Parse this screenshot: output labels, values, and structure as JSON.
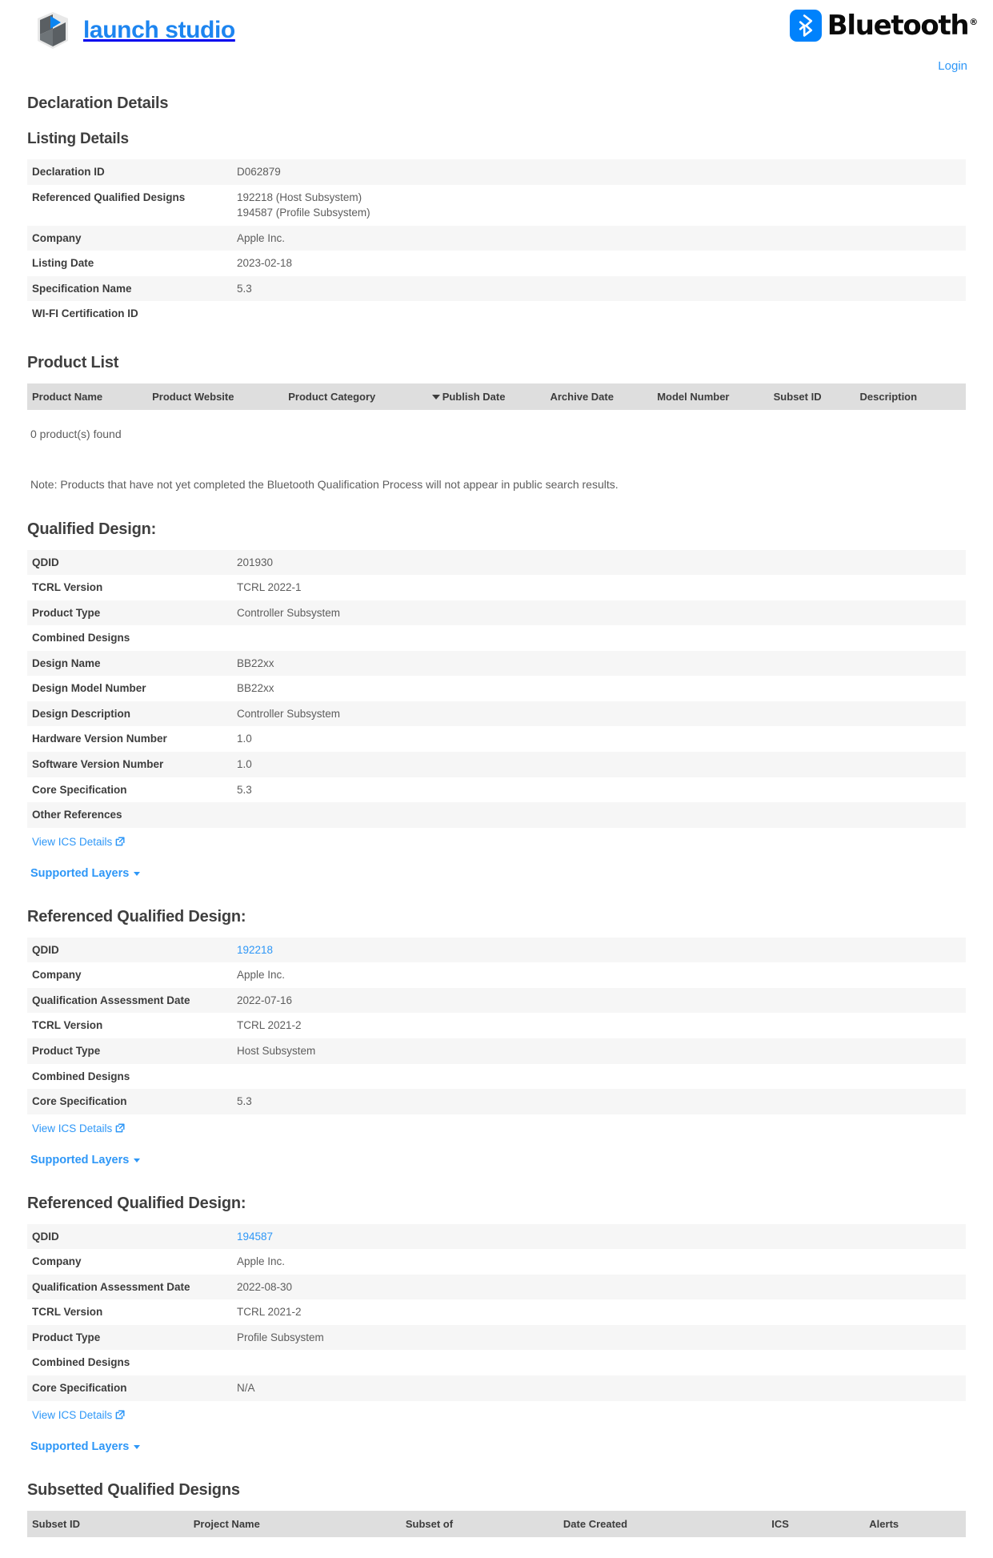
{
  "header": {
    "brand_text": "launch studio",
    "brand_color": "#1d85f0",
    "bluetooth_text": "Bluetooth",
    "bluetooth_reg": "®",
    "bluetooth_color": "#0082fc",
    "login_label": "Login"
  },
  "page": {
    "title": "Declaration Details"
  },
  "listing_details": {
    "title": "Listing Details",
    "rows": [
      {
        "label": "Declaration ID",
        "value": "D062879"
      },
      {
        "label": "Referenced Qualified Designs",
        "value_lines": [
          "192218 (Host Subsystem)",
          "194587 (Profile Subsystem)"
        ]
      },
      {
        "label": "Company",
        "value": "Apple Inc."
      },
      {
        "label": "Listing Date",
        "value": "2023-02-18"
      },
      {
        "label": "Specification Name",
        "value": "5.3"
      },
      {
        "label": "WI-FI Certification ID",
        "value": ""
      }
    ]
  },
  "product_list": {
    "title": "Product List",
    "columns": [
      "Product Name",
      "Product Website",
      "Product Category",
      "Publish Date",
      "Archive Date",
      "Model Number",
      "Subset ID",
      "Description"
    ],
    "sorted_column": "Publish Date",
    "sort_direction": "desc",
    "result_count_text": "0 product(s) found",
    "note": "Note: Products that have not yet completed the Bluetooth Qualification Process will not appear in public search results."
  },
  "qualified_design": {
    "title": "Qualified Design:",
    "rows": [
      {
        "label": "QDID",
        "value": "201930"
      },
      {
        "label": "TCRL Version",
        "value": "TCRL 2022-1"
      },
      {
        "label": "Product Type",
        "value": "Controller Subsystem"
      },
      {
        "label": "Combined Designs",
        "value": ""
      },
      {
        "label": "Design Name",
        "value": "BB22xx"
      },
      {
        "label": "Design Model Number",
        "value": "BB22xx"
      },
      {
        "label": "Design Description",
        "value": "Controller Subsystem"
      },
      {
        "label": "Hardware Version Number",
        "value": "1.0"
      },
      {
        "label": "Software Version Number",
        "value": "1.0"
      },
      {
        "label": "Core Specification",
        "value": "5.3"
      },
      {
        "label": "Other References",
        "value": ""
      }
    ],
    "ics_link_label": "View ICS Details",
    "supported_layers_label": "Supported Layers"
  },
  "referenced_design_1": {
    "title": "Referenced Qualified Design:",
    "rows": [
      {
        "label": "QDID",
        "value": "192218",
        "is_link": true
      },
      {
        "label": "Company",
        "value": "Apple Inc."
      },
      {
        "label": "Qualification Assessment Date",
        "value": "2022-07-16"
      },
      {
        "label": "TCRL Version",
        "value": "TCRL 2021-2"
      },
      {
        "label": "Product Type",
        "value": "Host Subsystem"
      },
      {
        "label": "Combined Designs",
        "value": ""
      },
      {
        "label": "Core Specification",
        "value": "5.3"
      }
    ],
    "ics_link_label": "View ICS Details",
    "supported_layers_label": "Supported Layers"
  },
  "referenced_design_2": {
    "title": "Referenced Qualified Design:",
    "rows": [
      {
        "label": "QDID",
        "value": "194587",
        "is_link": true
      },
      {
        "label": "Company",
        "value": "Apple Inc."
      },
      {
        "label": "Qualification Assessment Date",
        "value": "2022-08-30"
      },
      {
        "label": "TCRL Version",
        "value": "TCRL 2021-2"
      },
      {
        "label": "Product Type",
        "value": "Profile Subsystem"
      },
      {
        "label": "Combined Designs",
        "value": ""
      },
      {
        "label": "Core Specification",
        "value": "N/A"
      }
    ],
    "ics_link_label": "View ICS Details",
    "supported_layers_label": "Supported Layers"
  },
  "subsetted_designs": {
    "title": "Subsetted Qualified Designs",
    "columns": [
      "Subset ID",
      "Project Name",
      "Subset of",
      "Date Created",
      "ICS",
      "Alerts"
    ]
  },
  "colors": {
    "link": "#2e97f7",
    "row_alt": "#f6f6f6",
    "grid_header": "#dedede",
    "text": "#3c3c3c",
    "text_muted": "#5d5d5d"
  }
}
